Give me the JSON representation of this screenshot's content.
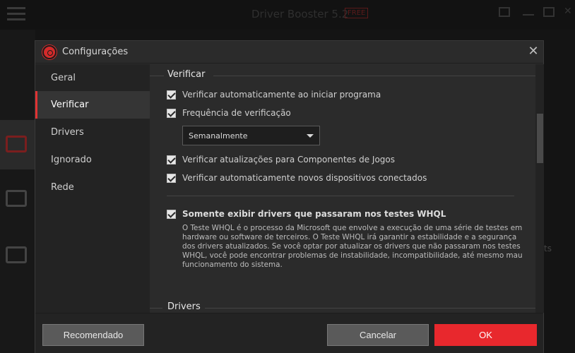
{
  "background": {
    "app_title": "Driver Booster 5.2",
    "free_badge": "FREE",
    "edge_text": "ts"
  },
  "dialog": {
    "title": "Configurações",
    "close_glyph": "✕",
    "nav": [
      {
        "label": "Geral",
        "active": false
      },
      {
        "label": "Verificar",
        "active": true
      },
      {
        "label": "Drivers",
        "active": false
      },
      {
        "label": "Ignorado",
        "active": false
      },
      {
        "label": "Rede",
        "active": false
      }
    ],
    "scan_section": {
      "heading": "Verificar",
      "options": [
        {
          "label": "Verificar automaticamente ao iniciar programa",
          "checked": true
        },
        {
          "label": "Frequência de verificação",
          "checked": true
        },
        {
          "label": "Verificar atualizações para Componentes de Jogos",
          "checked": true
        },
        {
          "label": "Verificar automaticamente novos dispositivos conectados",
          "checked": true
        }
      ],
      "frequency_select": {
        "selected": "Semanalmente"
      },
      "whql": {
        "label": "Somente exibir drivers que passaram nos testes WHQL",
        "checked": true,
        "description": "O Teste WHQL é o processo da Microsoft que envolve a execução de uma série de testes em hardware ou software de terceiros. O Teste WHQL irá garantir a estabilidade e a segurança dos drivers atualizados. Se você optar por atualizar os drivers que não passaram nos testes WHQL, você pode encontrar problemas de instabilidade, incompatibilidade, até mesmo mau funcionamento do sistema."
      }
    },
    "drivers_section": {
      "heading": "Drivers"
    },
    "footer": {
      "recommended": "Recomendado",
      "cancel": "Cancelar",
      "ok": "OK"
    }
  },
  "colors": {
    "accent": "#e8282d",
    "panel": "#2b2b2b",
    "nav_bg": "#232323"
  }
}
